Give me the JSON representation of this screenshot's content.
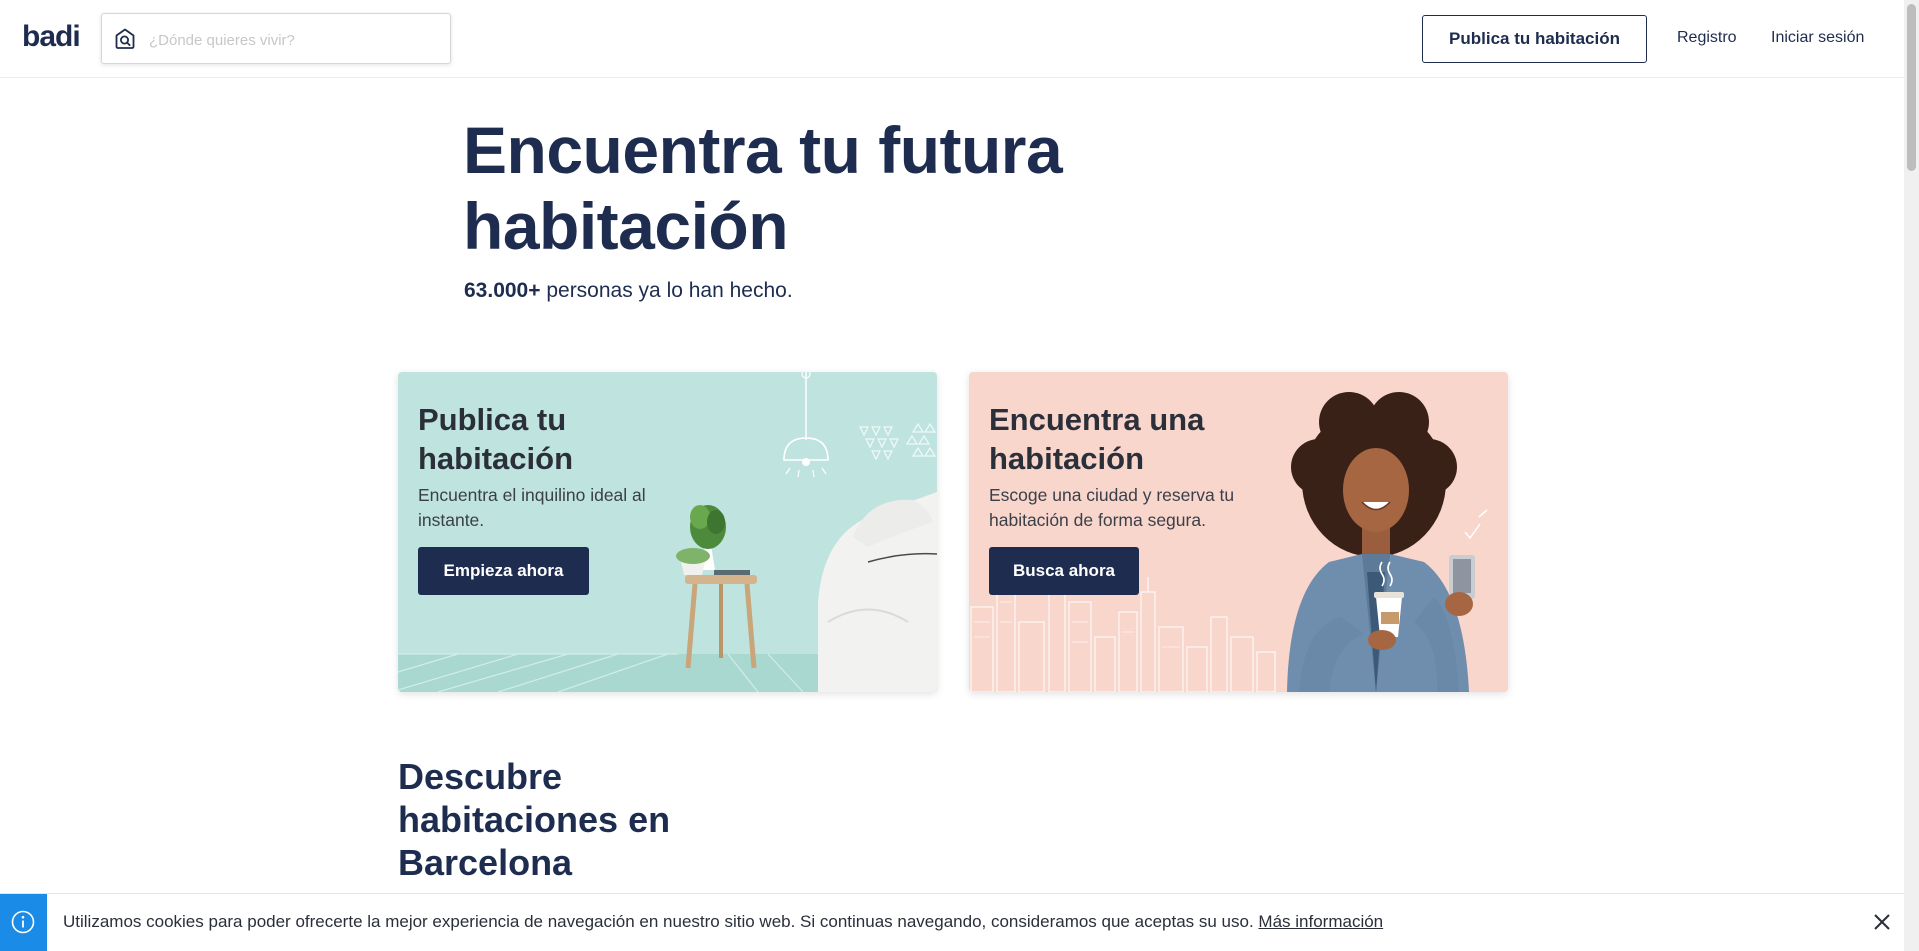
{
  "header": {
    "logo": "badi",
    "search": {
      "placeholder": "¿Dónde quieres vivir?",
      "value": ""
    },
    "publish_button": "Publica tu habitación",
    "register_link": "Registro",
    "login_link": "Iniciar sesión"
  },
  "hero": {
    "title": "Encuentra tu futura habitación",
    "count": "63.000+",
    "subtitle_rest": " personas ya lo han hecho."
  },
  "cards": [
    {
      "title": "Publica tu habitación",
      "description": "Encuentra el inquilino ideal al instante.",
      "button": "Empieza ahora"
    },
    {
      "title": "Encuentra una habitación",
      "description": "Escoge una ciudad y reserva tu habitación de forma segura.",
      "button": "Busca ahora"
    }
  ],
  "discover": {
    "title": "Descubre habitaciones en Barcelona"
  },
  "cookie": {
    "text": "Utilizamos cookies para poder ofrecerte la mejor experiencia de navegación en nuestro sitio web. Si continuas navegando, consideramos que aceptas su uso. ",
    "link": "Más información"
  },
  "colors": {
    "navy": "#1e2d4f",
    "teal_card": "#bfe3de",
    "peach_card": "#f8d6cb",
    "info_blue": "#1a8be6"
  },
  "icons": {
    "search": "search-home-icon",
    "info": "info-icon",
    "close": "close-icon"
  }
}
